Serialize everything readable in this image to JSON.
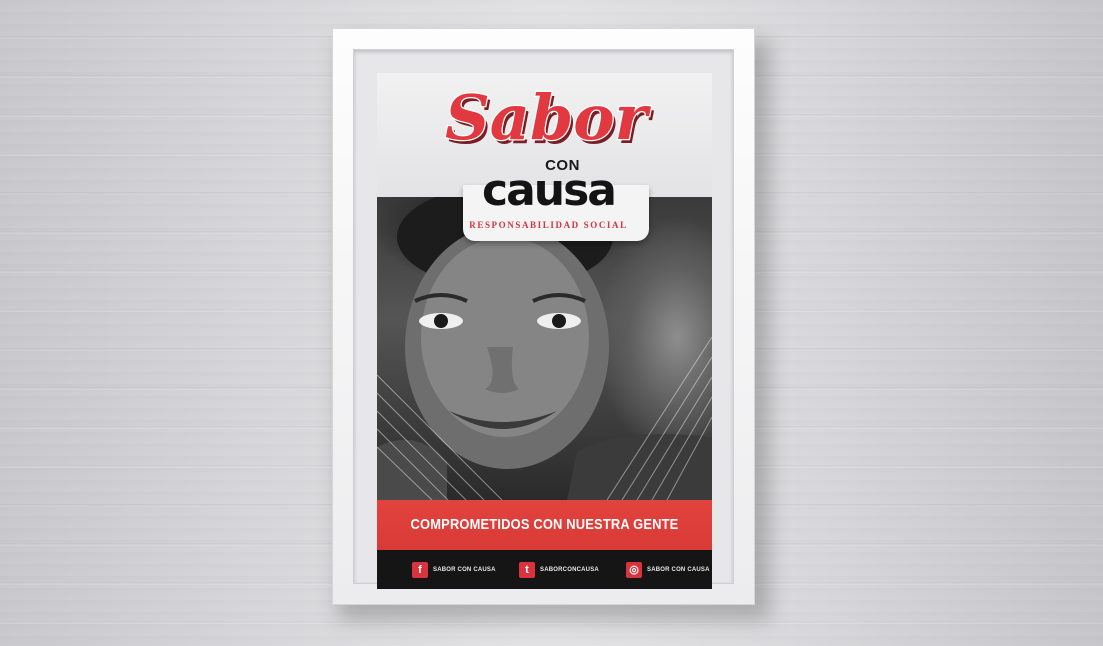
{
  "brand": {
    "logo_word": "Sabor",
    "con": "CON",
    "causa": "causa",
    "tagline": "RESPONSABILIDAD SOCIAL"
  },
  "banner": {
    "text": "COMPROMETIDOS CON NUESTRA GENTE"
  },
  "social": [
    {
      "icon": "facebook-icon",
      "glyph": "f",
      "label": "SABOR CON CAUSA"
    },
    {
      "icon": "twitter-icon",
      "glyph": "t",
      "label": "SABORCONCAUSA"
    },
    {
      "icon": "instagram-icon",
      "glyph": "◎",
      "label": "SABOR CON CAUSA"
    }
  ],
  "colors": {
    "brand_red": "#d9343d",
    "banner_red": "#e3433f",
    "footer_black": "#151515",
    "frame_white": "#f7f7f8"
  }
}
